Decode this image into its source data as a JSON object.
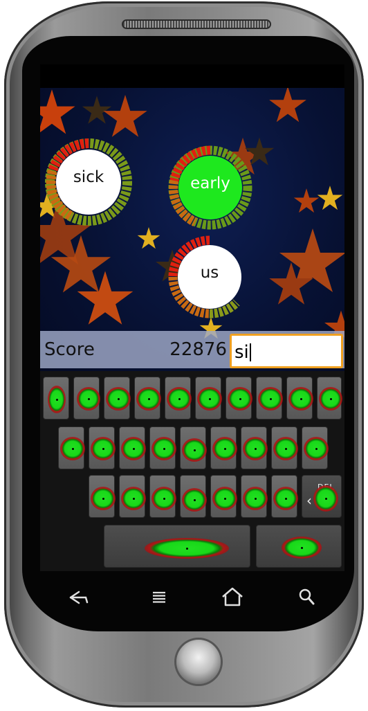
{
  "game": {
    "words": [
      {
        "text": "sick",
        "active": false
      },
      {
        "text": "early",
        "active": true
      },
      {
        "text": "us",
        "active": false
      }
    ],
    "score_label": "Score",
    "score_value": "22876",
    "typed_text": "si"
  },
  "keyboard": {
    "delete_label": "DEL"
  },
  "nav": {
    "back_icon": "back-icon",
    "menu_icon": "menu-icon",
    "home_icon": "home-icon",
    "search_icon": "search-icon"
  },
  "colors": {
    "sky": "#071133",
    "star_orange": "#c8400c",
    "star_yellow": "#e2b020",
    "active_bubble": "#1ee81e",
    "input_border": "#f0a020"
  }
}
